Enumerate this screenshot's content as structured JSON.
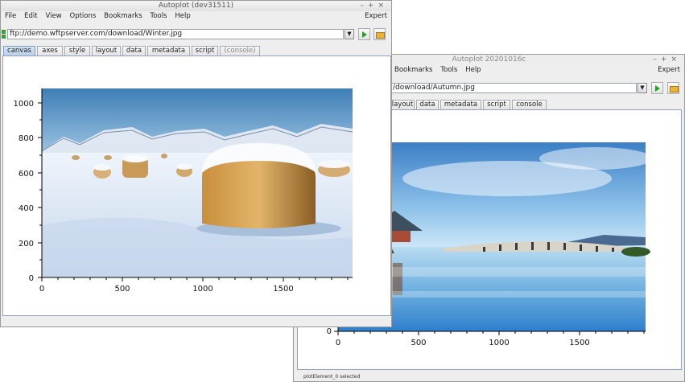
{
  "windows": [
    {
      "title": "Autoplot (dev31511)",
      "menu": [
        "File",
        "Edit",
        "View",
        "Options",
        "Bookmarks",
        "Tools",
        "Help"
      ],
      "expert_label": "Expert",
      "address": "ftp://demo.wftpserver.com/download/Winter.jpg",
      "tabs": [
        "canvas",
        "axes",
        "style",
        "layout",
        "data",
        "metadata",
        "script",
        "(console)"
      ],
      "selected_tab": "canvas",
      "plot": {
        "image_subject": "snowy field with hay bales and mountains",
        "y_ticks": [
          "1000",
          "800",
          "600",
          "400",
          "200",
          "0"
        ],
        "x_ticks": [
          "0",
          "500",
          "1000",
          "1500"
        ]
      }
    },
    {
      "title": "Autoplot 20201016c",
      "menu": [
        "Bookmarks",
        "Tools",
        "Help"
      ],
      "expert_label": "Expert",
      "address": "/download/Autumn.jpg",
      "tabs": [
        "layout",
        "data",
        "metadata",
        "script",
        "console"
      ],
      "plot": {
        "image_subject": "long bridge and pagoda reflected in lake under blue sky",
        "y_ticks": [
          "0"
        ],
        "x_ticks": [
          "0",
          "500",
          "1000",
          "1500"
        ]
      },
      "status": "plotElement_0 selected"
    }
  ],
  "colors": {
    "selected_tab": "#c6d8ee",
    "play_icon": "#2a9d2a",
    "folder_icon": "#e8b53a",
    "window_bg": "#eeeeee"
  }
}
